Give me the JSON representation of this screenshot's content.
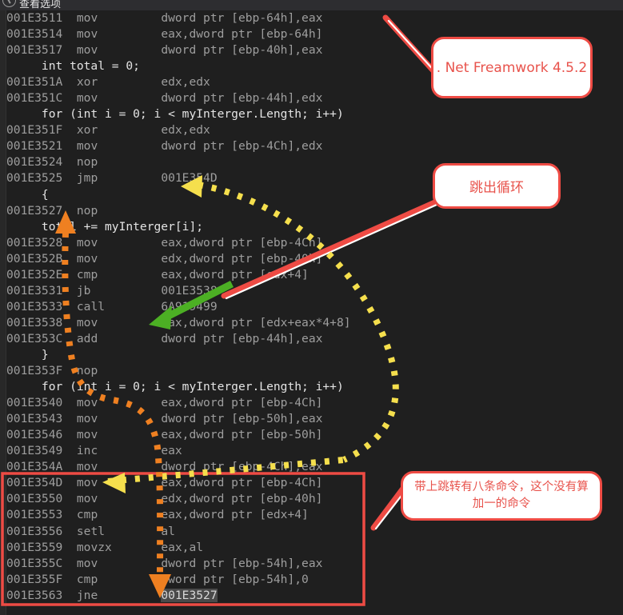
{
  "window": {
    "titlebar_text": "查看选项",
    "titlebar_icon": "clock-icon",
    "background": "#1f1f1f"
  },
  "colors": {
    "editor_bg": "#1f1f1f",
    "gutter_bg": "#282828",
    "chrome_bg": "#2d2d30",
    "address_text": "#9e9e9e",
    "source_text": "#e4e4e4",
    "highlight_bg": "#4a4a4a",
    "annotation_red": "#ee4b44",
    "annotation_orange": "#ef8021",
    "annotation_yellow": "#f5df4d",
    "annotation_green": "#4caf24"
  },
  "disassembly": {
    "lines": [
      {
        "kind": "asm",
        "address": "001E3511",
        "mnemonic": "mov",
        "operands": "dword ptr [ebp-64h],eax"
      },
      {
        "kind": "asm",
        "address": "001E3514",
        "mnemonic": "mov",
        "operands": "eax,dword ptr [ebp-64h]"
      },
      {
        "kind": "asm",
        "address": "001E3517",
        "mnemonic": "mov",
        "operands": "dword ptr [ebp-40h],eax"
      },
      {
        "kind": "source",
        "text": "int total = 0;"
      },
      {
        "kind": "asm",
        "address": "001E351A",
        "mnemonic": "xor",
        "operands": "edx,edx"
      },
      {
        "kind": "asm",
        "address": "001E351C",
        "mnemonic": "mov",
        "operands": "dword ptr [ebp-44h],edx"
      },
      {
        "kind": "source",
        "text": "for (int i = 0; i < myInterger.Length; i++)"
      },
      {
        "kind": "asm",
        "address": "001E351F",
        "mnemonic": "xor",
        "operands": "edx,edx"
      },
      {
        "kind": "asm",
        "address": "001E3521",
        "mnemonic": "mov",
        "operands": "dword ptr [ebp-4Ch],edx"
      },
      {
        "kind": "asm",
        "address": "001E3524",
        "mnemonic": "nop",
        "operands": ""
      },
      {
        "kind": "asm",
        "address": "001E3525",
        "mnemonic": "jmp",
        "operands": "001E354D"
      },
      {
        "kind": "source",
        "text": "{"
      },
      {
        "kind": "asm",
        "address": "001E3527",
        "mnemonic": "nop",
        "operands": ""
      },
      {
        "kind": "source",
        "text": "total += myInterger[i];"
      },
      {
        "kind": "asm",
        "address": "001E3528",
        "mnemonic": "mov",
        "operands": "eax,dword ptr [ebp-4Ch]"
      },
      {
        "kind": "asm",
        "address": "001E352B",
        "mnemonic": "mov",
        "operands": "edx,dword ptr [ebp-40h]"
      },
      {
        "kind": "asm",
        "address": "001E352E",
        "mnemonic": "cmp",
        "operands": "eax,dword ptr [edx+4]"
      },
      {
        "kind": "asm",
        "address": "001E3531",
        "mnemonic": "jb",
        "operands": "001E3538"
      },
      {
        "kind": "asm",
        "address": "001E3533",
        "mnemonic": "call",
        "operands": "6A919499"
      },
      {
        "kind": "asm",
        "address": "001E3538",
        "mnemonic": "mov",
        "operands": "eax,dword ptr [edx+eax*4+8]"
      },
      {
        "kind": "asm",
        "address": "001E353C",
        "mnemonic": "add",
        "operands": "dword ptr [ebp-44h],eax"
      },
      {
        "kind": "source",
        "text": "}"
      },
      {
        "kind": "asm",
        "address": "001E353F",
        "mnemonic": "nop",
        "operands": ""
      },
      {
        "kind": "source",
        "text": "for (int i = 0; i < myInterger.Length; i++)"
      },
      {
        "kind": "asm",
        "address": "001E3540",
        "mnemonic": "mov",
        "operands": "eax,dword ptr [ebp-4Ch]"
      },
      {
        "kind": "asm",
        "address": "001E3543",
        "mnemonic": "mov",
        "operands": "dword ptr [ebp-50h],eax"
      },
      {
        "kind": "asm",
        "address": "001E3546",
        "mnemonic": "mov",
        "operands": "eax,dword ptr [ebp-50h]"
      },
      {
        "kind": "asm",
        "address": "001E3549",
        "mnemonic": "inc",
        "operands": "eax"
      },
      {
        "kind": "asm",
        "address": "001E354A",
        "mnemonic": "mov",
        "operands": "dword ptr [ebp-4Ch],eax"
      },
      {
        "kind": "asm",
        "address": "001E354D",
        "mnemonic": "mov",
        "operands": "eax,dword ptr [ebp-4Ch]"
      },
      {
        "kind": "asm",
        "address": "001E3550",
        "mnemonic": "mov",
        "operands": "edx,dword ptr [ebp-40h]"
      },
      {
        "kind": "asm",
        "address": "001E3553",
        "mnemonic": "cmp",
        "operands": "eax,dword ptr [edx+4]"
      },
      {
        "kind": "asm",
        "address": "001E3556",
        "mnemonic": "setl",
        "operands": "al"
      },
      {
        "kind": "asm",
        "address": "001E3559",
        "mnemonic": "movzx",
        "operands": "eax,al"
      },
      {
        "kind": "asm",
        "address": "001E355C",
        "mnemonic": "mov",
        "operands": "dword ptr [ebp-54h],eax"
      },
      {
        "kind": "asm",
        "address": "001E355F",
        "mnemonic": "cmp",
        "operands": "dword ptr [ebp-54h],0"
      },
      {
        "kind": "asm",
        "address": "001E3563",
        "mnemonic": "jne",
        "operands": "001E3527",
        "operands_highlighted": true
      }
    ]
  },
  "annotations": {
    "callouts": [
      {
        "id": "net-framework",
        "text": ". Net Freamwork 4.5.2"
      },
      {
        "id": "jump-out-loop",
        "text": "跳出循环"
      },
      {
        "id": "eight-instructions",
        "text": "带上跳转有八条命令，这个没有算加一的命令"
      }
    ],
    "arrows": [
      {
        "id": "green-arrow",
        "color": "#4caf24",
        "points_to": "001E3538 mov"
      },
      {
        "id": "yellow-arrow-top",
        "color": "#f5df4d",
        "points_to": "001E3525 jmp 001E354D"
      },
      {
        "id": "yellow-arrow-bottom",
        "color": "#f5df4d",
        "points_to": "001E354D mov"
      },
      {
        "id": "orange-loop-arrow-up",
        "color": "#ef8021",
        "points_to": "001E3527 nop"
      },
      {
        "id": "orange-loop-arrow-down",
        "color": "#ef8021",
        "points_to": "001E3563 jne 001E3527"
      }
    ],
    "highlight_box": {
      "id": "loop-condition-box",
      "color": "#ee4b44"
    }
  }
}
